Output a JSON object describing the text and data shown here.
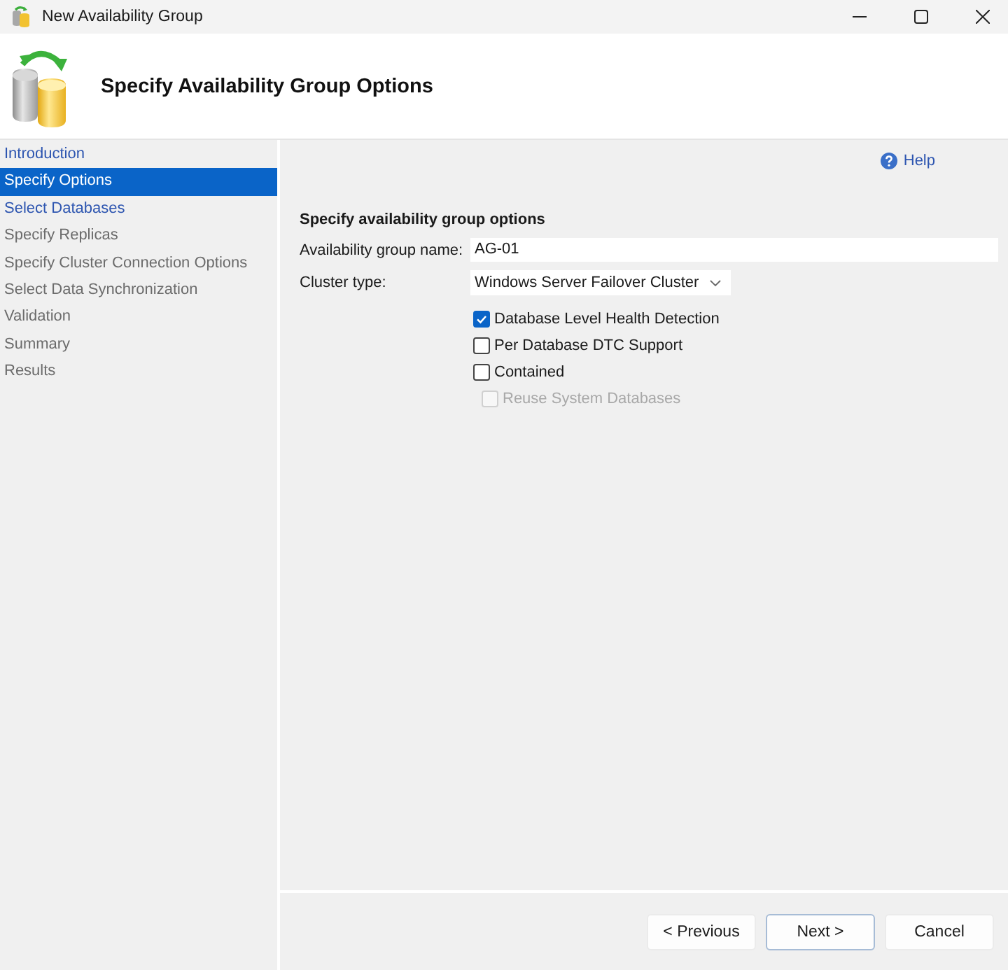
{
  "window": {
    "title": "New Availability Group"
  },
  "header": {
    "title": "Specify Availability Group Options"
  },
  "steps": [
    {
      "label": "Introduction",
      "selected": false,
      "disabled": false
    },
    {
      "label": "Specify Options",
      "selected": true,
      "disabled": false
    },
    {
      "label": "Select Databases",
      "selected": false,
      "disabled": false
    },
    {
      "label": "Specify Replicas",
      "selected": false,
      "disabled": true
    },
    {
      "label": "Specify Cluster Connection Options",
      "selected": false,
      "disabled": true
    },
    {
      "label": "Select Data Synchronization",
      "selected": false,
      "disabled": true
    },
    {
      "label": "Validation",
      "selected": false,
      "disabled": true
    },
    {
      "label": "Summary",
      "selected": false,
      "disabled": true
    },
    {
      "label": "Results",
      "selected": false,
      "disabled": true
    }
  ],
  "help": {
    "label": "Help"
  },
  "section": {
    "title": "Specify availability group options"
  },
  "fields": [
    {
      "kind": "text",
      "label": "Availability group name:",
      "value": "AG-01"
    },
    {
      "kind": "dropdown",
      "label": "Cluster type:",
      "value": "Windows Server Failover Cluster"
    }
  ],
  "options": [
    {
      "label": "Database Level Health Detection",
      "checked": true,
      "disabled": false
    },
    {
      "label": "Per Database DTC Support",
      "checked": false,
      "disabled": false
    },
    {
      "label": "Contained",
      "checked": false,
      "disabled": false,
      "children": [
        {
          "label": "Reuse System Databases",
          "checked": false,
          "disabled": true
        }
      ]
    }
  ],
  "buttons": [
    {
      "label": "< Previous",
      "default": false
    },
    {
      "label": "Next >",
      "default": true
    },
    {
      "label": "Cancel",
      "default": false
    }
  ]
}
